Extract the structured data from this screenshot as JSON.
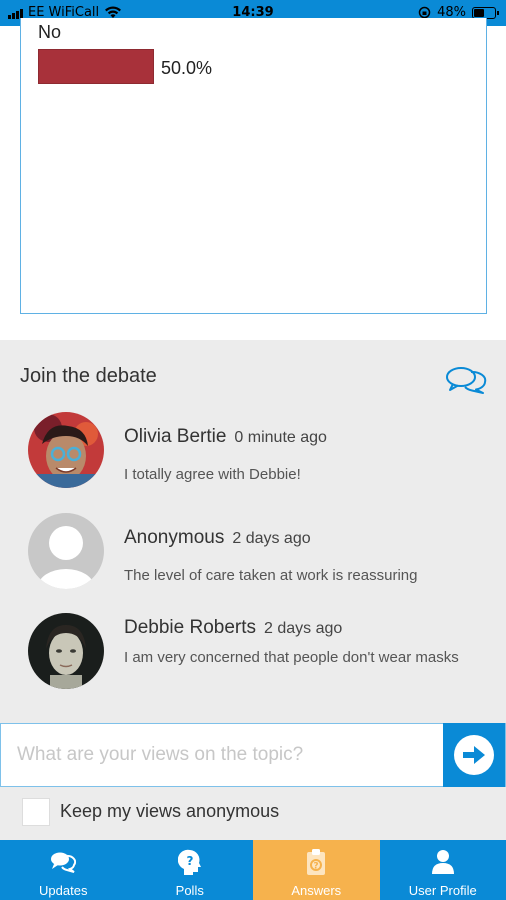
{
  "status_bar": {
    "carrier": "EE WiFiCall",
    "time": "14:39",
    "battery": "48%",
    "battery_level": 0.48
  },
  "poll": {
    "option_label": "No",
    "percentage_text": "50.0%",
    "percentage": 50.0,
    "bar_color": "#a8313a"
  },
  "debate": {
    "title": "Join the debate",
    "comments": [
      {
        "name": "Olivia Bertie",
        "time": "0 minute ago",
        "text": "I totally agree with Debbie!"
      },
      {
        "name": "Anonymous",
        "time": "2 days ago",
        "text": "The level of care taken at work is reassuring"
      },
      {
        "name": "Debbie Roberts",
        "time": "2 days ago",
        "text": "I am very concerned that people don't wear masks"
      }
    ]
  },
  "composer": {
    "placeholder": "What are your views on the topic?",
    "value": "",
    "anonymous_label": "Keep my views anonymous",
    "anonymous_checked": false
  },
  "nav": {
    "items": [
      {
        "label": "Updates",
        "icon": "chat-bubbles-icon"
      },
      {
        "label": "Polls",
        "icon": "head-question-icon"
      },
      {
        "label": "Answers",
        "icon": "clipboard-icon"
      },
      {
        "label": "User Profile",
        "icon": "user-icon"
      }
    ],
    "active": "Answers"
  },
  "colors": {
    "primary": "#0a8ad6",
    "active_tab": "#f6b24d",
    "poll_bar": "#a8313a",
    "section_bg": "#ececec"
  }
}
